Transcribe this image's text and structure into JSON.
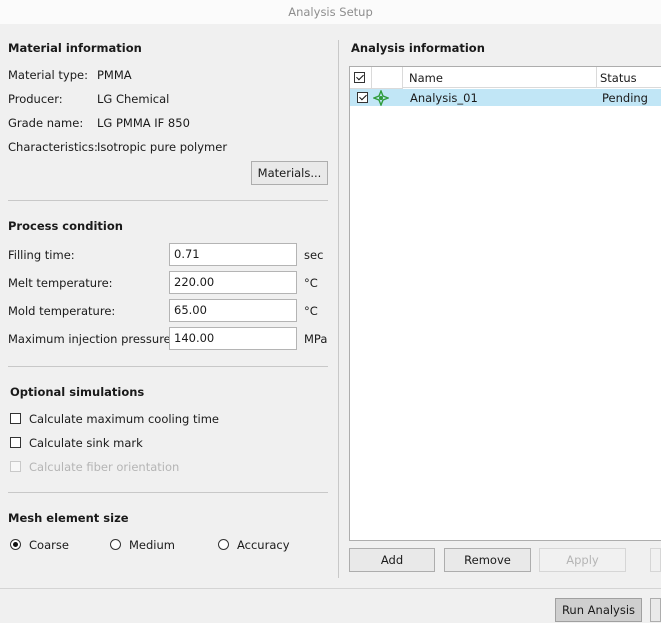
{
  "window": {
    "title": "Analysis Setup"
  },
  "material": {
    "title": "Material information",
    "type_label": "Material type:",
    "type_value": "PMMA",
    "producer_label": "Producer:",
    "producer_value": "LG Chemical",
    "grade_label": "Grade name:",
    "grade_value": "LG PMMA IF 850",
    "char_label": "Characteristics:",
    "char_value": "Isotropic pure polymer",
    "materials_button": "Materials..."
  },
  "process": {
    "title": "Process condition",
    "filling_label": "Filling time:",
    "filling_value": "0.71",
    "filling_unit": "sec",
    "melt_label": "Melt temperature:",
    "melt_value": "220.00",
    "melt_unit": "°C",
    "mold_label": "Mold temperature:",
    "mold_value": "65.00",
    "mold_unit": "°C",
    "pressure_label": "Maximum injection pressure:",
    "pressure_value": "140.00",
    "pressure_unit": "MPa"
  },
  "optional": {
    "title": "Optional simulations",
    "cooling": "Calculate maximum cooling time",
    "sink": "Calculate sink mark",
    "fiber": "Calculate fiber orientation"
  },
  "mesh": {
    "title": "Mesh element size",
    "coarse": "Coarse",
    "medium": "Medium",
    "accuracy": "Accuracy",
    "selected": "Coarse"
  },
  "analysis": {
    "title": "Analysis information",
    "columns": {
      "name": "Name",
      "status": "Status"
    },
    "rows": [
      {
        "name": "Analysis_01",
        "status": "Pending",
        "checked": true,
        "icon": "analysis-target-icon"
      }
    ],
    "add_button": "Add",
    "remove_button": "Remove",
    "apply_button": "Apply"
  },
  "footer": {
    "run_button": "Run Analysis"
  },
  "colors": {
    "selected_row": "#c1e6f6",
    "icon_green": "#2e9b3a"
  }
}
